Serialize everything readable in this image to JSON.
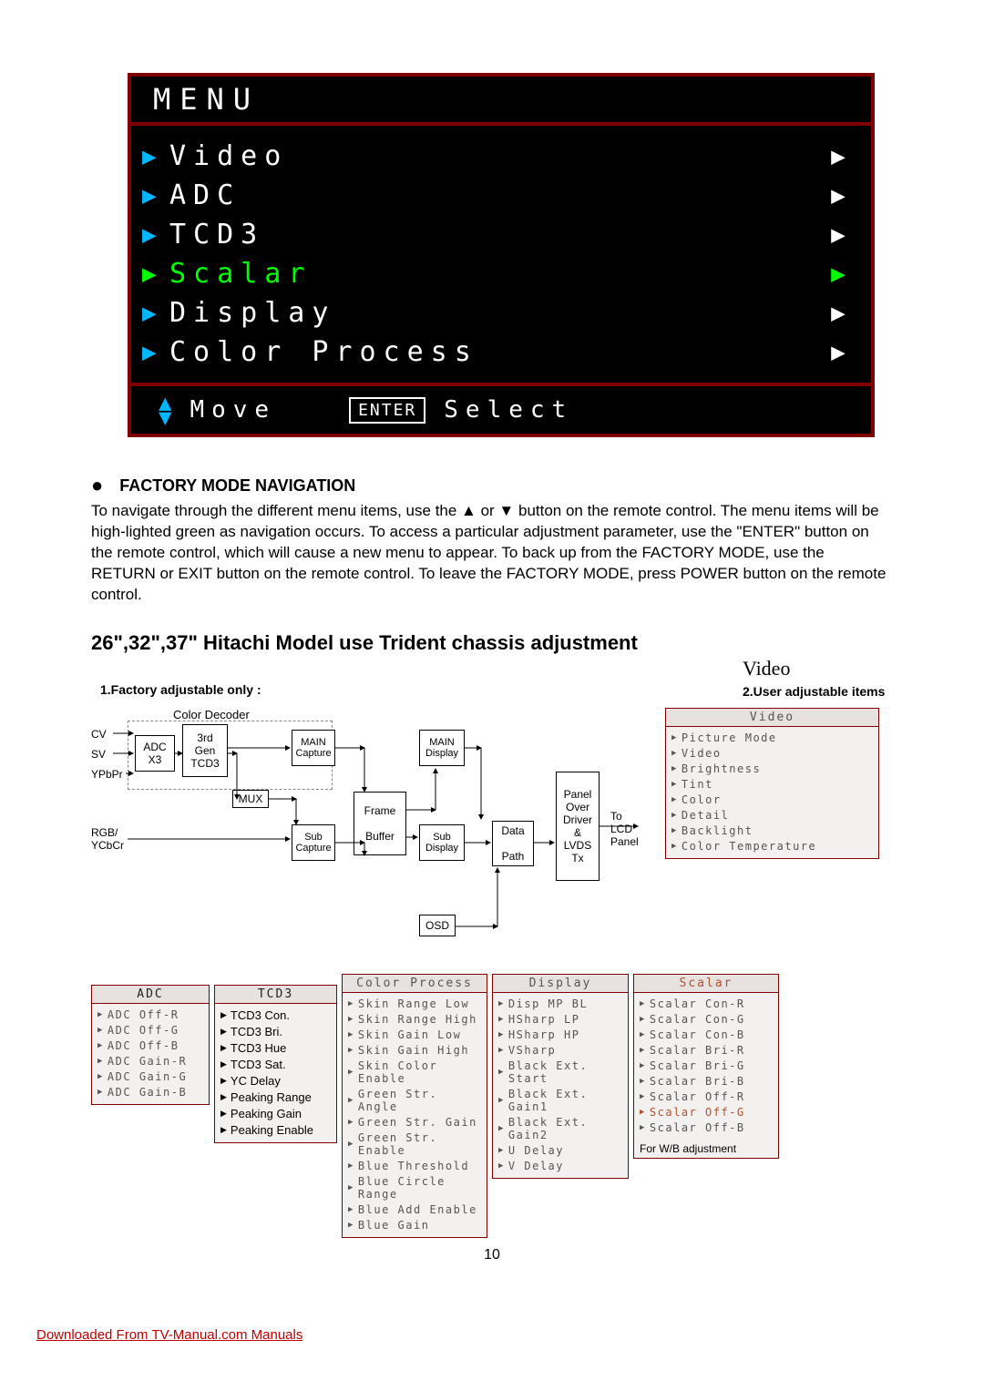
{
  "osd": {
    "title": "MENU",
    "items": [
      {
        "label": "Video",
        "selected": false
      },
      {
        "label": "ADC",
        "selected": false
      },
      {
        "label": "TCD3",
        "selected": false
      },
      {
        "label": "Scalar",
        "selected": true
      },
      {
        "label": "Display",
        "selected": false
      },
      {
        "label": "Color Process",
        "selected": false
      }
    ],
    "footer": {
      "move": "Move",
      "enter_key": "ENTER",
      "select": "Select"
    }
  },
  "section": {
    "bullet": "●",
    "heading": "FACTORY MODE NAVIGATION",
    "para": "To navigate through the different menu items, use the ▲ or ▼ button on the remote control. The menu items will be high-lighted green as navigation occurs. To access a particular adjustment parameter, use the \"ENTER\" button on the remote control, which will cause a new menu to appear. To back up from the FACTORY MODE, use the RETURN or EXIT button on the remote control. To leave the FACTORY MODE, press POWER button on the remote control."
  },
  "h2": "26\",32\",37\" Hitachi Model use Trident chassis adjustment",
  "diagram": {
    "note1": "1.Factory adjustable only :",
    "video_title": "Video",
    "note2": "2.User adjustable items",
    "inputs": [
      "CV",
      "SV",
      "YPbPr",
      "RGB/\nYCbCr"
    ],
    "group_label": "Color Decoder",
    "boxes": {
      "adc": "ADC\nX3",
      "tcd3_gen": "3rd\nGen\nTCD3",
      "main_cap": "MAIN\nCapture",
      "sub_cap": "Sub\nCapture",
      "mux": "MUX",
      "frame_buf": "Frame\n\nBuffer",
      "main_disp": "MAIN\nDisplay",
      "sub_disp": "Sub\nDisplay",
      "data_path": "Data\n\nPath",
      "panel_over": "Panel\nOver\nDriver\n&\nLVDS\nTx",
      "to_lcd": "To\nLCD\nPanel",
      "osd": "OSD"
    },
    "menus": {
      "video": {
        "title": "Video",
        "items": [
          "Picture Mode",
          "Video",
          "Brightness",
          "Tint",
          "Color",
          "Detail",
          "Backlight",
          "Color Temperature"
        ]
      },
      "adc": {
        "title": "ADC",
        "items": [
          "ADC Off-R",
          "ADC Off-G",
          "ADC Off-B",
          "ADC Gain-R",
          "ADC Gain-G",
          "ADC Gain-B"
        ]
      },
      "tcd3": {
        "title": "TCD3",
        "items": [
          "TCD3 Con.",
          "TCD3 Bri.",
          "TCD3 Hue",
          "TCD3 Sat.",
          "YC Delay",
          "Peaking Range",
          "Peaking Gain",
          "Peaking Enable"
        ]
      },
      "color_process": {
        "title": "Color Process",
        "items": [
          "Skin Range Low",
          "Skin Range High",
          "Skin Gain Low",
          "Skin Gain High",
          "Skin Color Enable",
          "Green Str. Angle",
          "Green Str. Gain",
          "Green Str. Enable",
          "Blue Threshold",
          "Blue Circle Range",
          "Blue Add Enable",
          "Blue Gain"
        ]
      },
      "display": {
        "title": "Display",
        "items": [
          "Disp MP BL",
          "HSharp LP",
          "HSharp HP",
          "VSharp",
          "Black Ext. Start",
          "Black Ext. Gain1",
          "Black Ext. Gain2",
          "U Delay",
          "V Delay"
        ]
      },
      "scalar": {
        "title": "Scalar",
        "items": [
          "Scalar Con-R",
          "Scalar Con-G",
          "Scalar Con-B",
          "Scalar Bri-R",
          "Scalar Bri-G",
          "Scalar Bri-B",
          "Scalar Off-R",
          "Scalar Off-G",
          "Scalar Off-B"
        ],
        "footer": "For W/B adjustment"
      }
    }
  },
  "page_number": "10",
  "download_link": "Downloaded From TV-Manual.com Manuals"
}
